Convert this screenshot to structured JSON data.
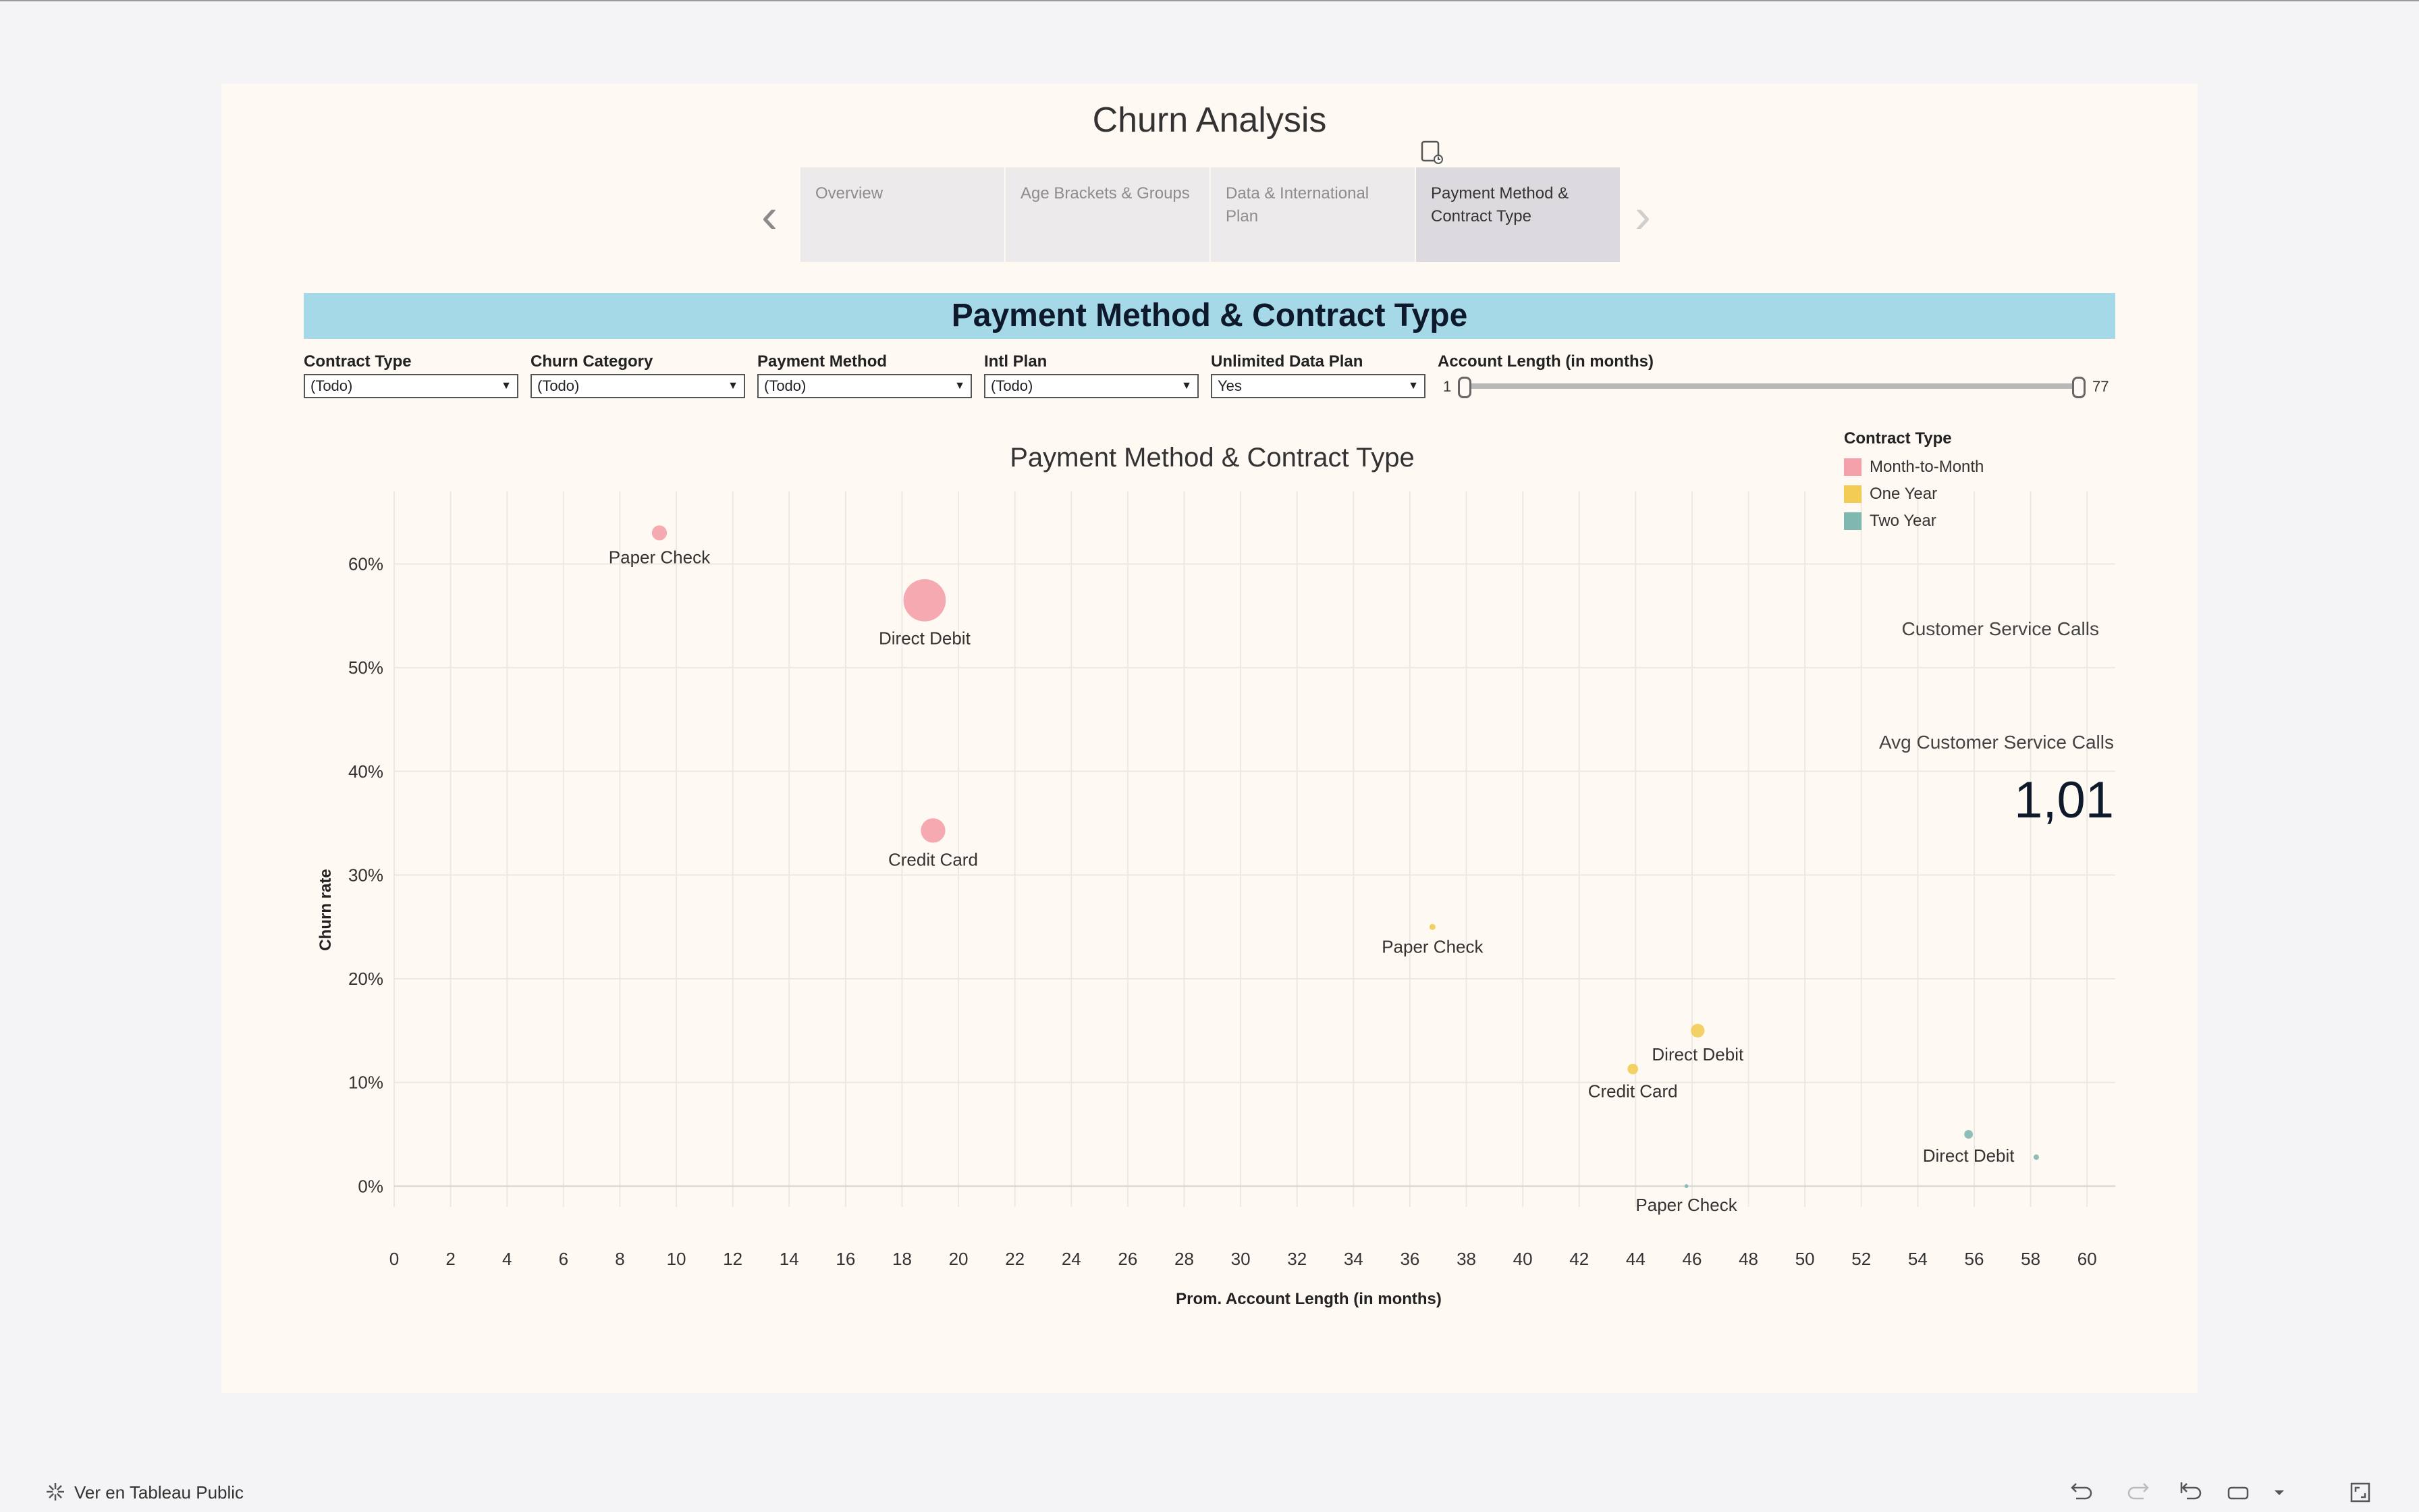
{
  "dashboard": {
    "title": "Churn Analysis",
    "tabs": [
      {
        "label": "Overview"
      },
      {
        "label": "Age Brackets & Groups"
      },
      {
        "label": "Data & International Plan"
      },
      {
        "label": "Payment Method & Contract Type"
      }
    ],
    "active_tab": 3,
    "banner": "Payment Method & Contract Type"
  },
  "filters": [
    {
      "label": "Contract Type",
      "value": "(Todo)"
    },
    {
      "label": "Churn Category",
      "value": "(Todo)"
    },
    {
      "label": "Payment Method",
      "value": "(Todo)"
    },
    {
      "label": "Intl Plan",
      "value": "(Todo)"
    },
    {
      "label": "Unlimited Data Plan",
      "value": "Yes"
    }
  ],
  "slider": {
    "label": "Account Length (in months)",
    "min": "1",
    "max": "77",
    "range": [
      1,
      77
    ]
  },
  "legend": {
    "title": "Contract Type",
    "items": [
      {
        "label": "Month-to-Month",
        "color": "#f4a0aa"
      },
      {
        "label": "One Year",
        "color": "#f2cc55"
      },
      {
        "label": "Two Year",
        "color": "#7fb8b0"
      }
    ]
  },
  "side_panel": {
    "csc_title": "Customer Service Calls",
    "avg_title": "Avg Customer Service Calls",
    "avg_value": "1,01"
  },
  "chart_data": {
    "type": "scatter",
    "title": "Payment Method & Contract Type",
    "xlabel": "Prom. Account Length (in months)",
    "ylabel": "Churn rate",
    "xlim": [
      0,
      61
    ],
    "ylim": [
      -0.02,
      0.67
    ],
    "x_ticks": [
      0,
      2,
      4,
      6,
      8,
      10,
      12,
      14,
      16,
      18,
      20,
      22,
      24,
      26,
      28,
      30,
      32,
      34,
      36,
      38,
      40,
      42,
      44,
      46,
      48,
      50,
      52,
      54,
      56,
      58,
      60
    ],
    "y_ticks": [
      {
        "value": 0,
        "label": "0%"
      },
      {
        "value": 0.1,
        "label": "10%"
      },
      {
        "value": 0.2,
        "label": "20%"
      },
      {
        "value": 0.3,
        "label": "30%"
      },
      {
        "value": 0.4,
        "label": "40%"
      },
      {
        "value": 0.5,
        "label": "50%"
      },
      {
        "value": 0.6,
        "label": "60%"
      }
    ],
    "grid": true,
    "legend_position": "top-right",
    "series": [
      {
        "name": "Month-to-Month",
        "color": "#f4a0aa",
        "points": [
          {
            "label": "Paper Check",
            "x": 9.4,
            "y": 0.63,
            "size": 3
          },
          {
            "label": "Direct Debit",
            "x": 18.8,
            "y": 0.565,
            "size": 24
          },
          {
            "label": "Credit Card",
            "x": 19.1,
            "y": 0.343,
            "size": 8
          }
        ]
      },
      {
        "name": "One Year",
        "color": "#f2cc55",
        "points": [
          {
            "label": "Paper Check",
            "x": 36.8,
            "y": 0.25,
            "size": 0.5
          },
          {
            "label": "Direct Debit",
            "x": 46.2,
            "y": 0.15,
            "size": 2.5
          },
          {
            "label": "Credit Card",
            "x": 43.9,
            "y": 0.113,
            "size": 1.5
          }
        ]
      },
      {
        "name": "Two Year",
        "color": "#7fb8b0",
        "points": [
          {
            "label": "Direct Debit",
            "x": 55.8,
            "y": 0.05,
            "size": 1
          },
          {
            "label": "",
            "x": 58.2,
            "y": 0.028,
            "size": 0.4
          },
          {
            "label": "Paper Check",
            "x": 45.8,
            "y": 0.0,
            "size": 0.2
          }
        ]
      }
    ]
  },
  "footer": {
    "tableau_link": "Ver en Tableau Public"
  }
}
